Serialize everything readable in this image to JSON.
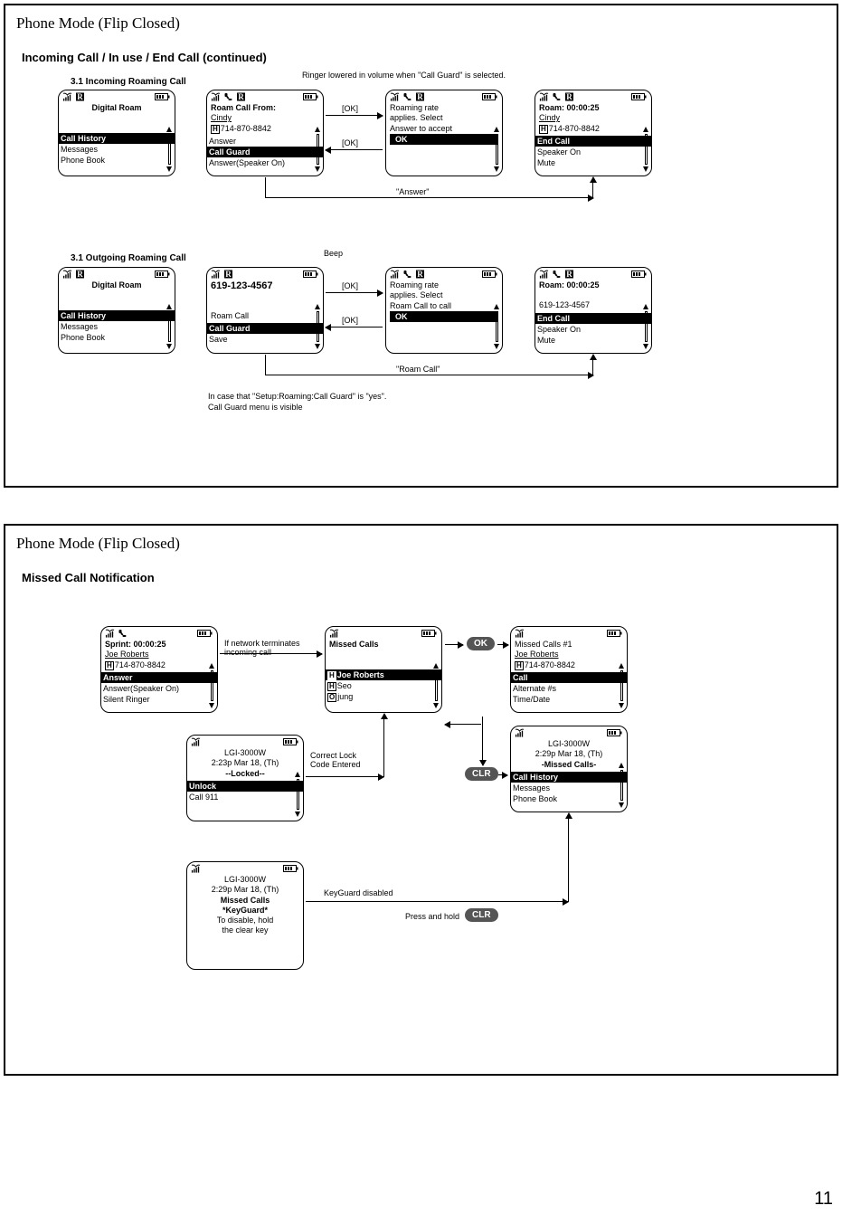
{
  "pagenum": "11",
  "panel1": {
    "title": "Phone Mode (Flip Closed)",
    "subtitle": "Incoming Call / In use / End Call (continued)",
    "sec_a": {
      "heading": "3.1 Incoming Roaming Call",
      "ringer_note": "Ringer lowered in volume when \"Call Guard\" is selected.",
      "ok1": "[OK]",
      "ok2": "[OK]",
      "answer_lbl": "\"Answer\"",
      "p1": {
        "title": "Digital Roam",
        "m1": "Call History",
        "m2": "Messages",
        "m3": "Phone Book"
      },
      "p2": {
        "title": "Roam Call From:",
        "name": "Cindy",
        "num": "714-870-8842",
        "ntype": "H",
        "m1": "Answer",
        "m2": "Call Guard",
        "m3": "Answer(Speaker On)"
      },
      "p3": {
        "l1": "Roaming rate",
        "l2": "applies. Select",
        "l3": "Answer to accept",
        "ok": "OK"
      },
      "p4": {
        "title": "Roam:  00:00:25",
        "name": "Cindy",
        "num": "714-870-8842",
        "ntype": "H",
        "m1": "End Call",
        "m2": "Speaker On",
        "m3": "Mute"
      }
    },
    "sec_b": {
      "heading": "3.1 Outgoing Roaming Call",
      "beep": "Beep",
      "ok1": "[OK]",
      "ok2": "[OK]",
      "roamcall": "\"Roam Call\"",
      "footnote1": "In case that \"Setup:Roaming:Call Guard\" is \"yes\".",
      "footnote2": "Call Guard menu is visible",
      "p1": {
        "title": "Digital Roam",
        "m1": "Call History",
        "m2": "Messages",
        "m3": "Phone Book"
      },
      "p2": {
        "title": "619-123-4567",
        "l1": "Roam Call",
        "m1": "Call Guard",
        "m2": "Save"
      },
      "p3": {
        "l1": "Roaming rate",
        "l2": "applies. Select",
        "l3": "Roam Call to call",
        "ok": "OK"
      },
      "p4": {
        "title": "Roam:  00:00:25",
        "num": "619-123-4567",
        "m1": "End Call",
        "m2": "Speaker On",
        "m3": "Mute"
      }
    }
  },
  "panel2": {
    "title": "Phone Mode (Flip Closed)",
    "subtitle": "Missed Call Notification",
    "okbtn": "OK",
    "clrbtn": "CLR",
    "clrbtn2": "CLR",
    "terminate_note": "If network terminates\nincoming call",
    "lock_note": "Correct Lock\nCode Entered",
    "kg_note": "KeyGuard disabled",
    "hold_note": "Press and hold",
    "p1": {
      "title": "Sprint:  00:00:25",
      "name": "Joe Roberts",
      "num": "714-870-8842",
      "ntype": "H",
      "m1": "Answer",
      "m2": "Answer(Speaker On)",
      "m3": "Silent Ringer"
    },
    "p2": {
      "title": "Missed Calls",
      "r1": "Joe Roberts",
      "r1t": "H",
      "r2": "Seo",
      "r2t": "H",
      "r3": "jung",
      "r3t": "O"
    },
    "p3": {
      "title": "Missed Calls #1",
      "name": "Joe Roberts",
      "num": "714-870-8842",
      "ntype": "H",
      "m1": "Call",
      "m2": "Alternate #s",
      "m3": "Time/Date"
    },
    "p4": {
      "model": "LGI-3000W",
      "time": "2:23p Mar 18, (Th)",
      "locked": "--Locked--",
      "m1": "Unlock",
      "m2": "Call 911"
    },
    "p5": {
      "model": "LGI-3000W",
      "time": "2:29p Mar 18, (Th)",
      "miss": "-Missed Calls-",
      "m1": "Call History",
      "m2": "Messages",
      "m3": "Phone Book"
    },
    "p6": {
      "model": "LGI-3000W",
      "time": "2:29p Mar 18, (Th)",
      "miss": "Missed Calls",
      "kg": "*KeyGuard*",
      "kg2": "To disable, hold",
      "kg3": "the clear key"
    }
  }
}
